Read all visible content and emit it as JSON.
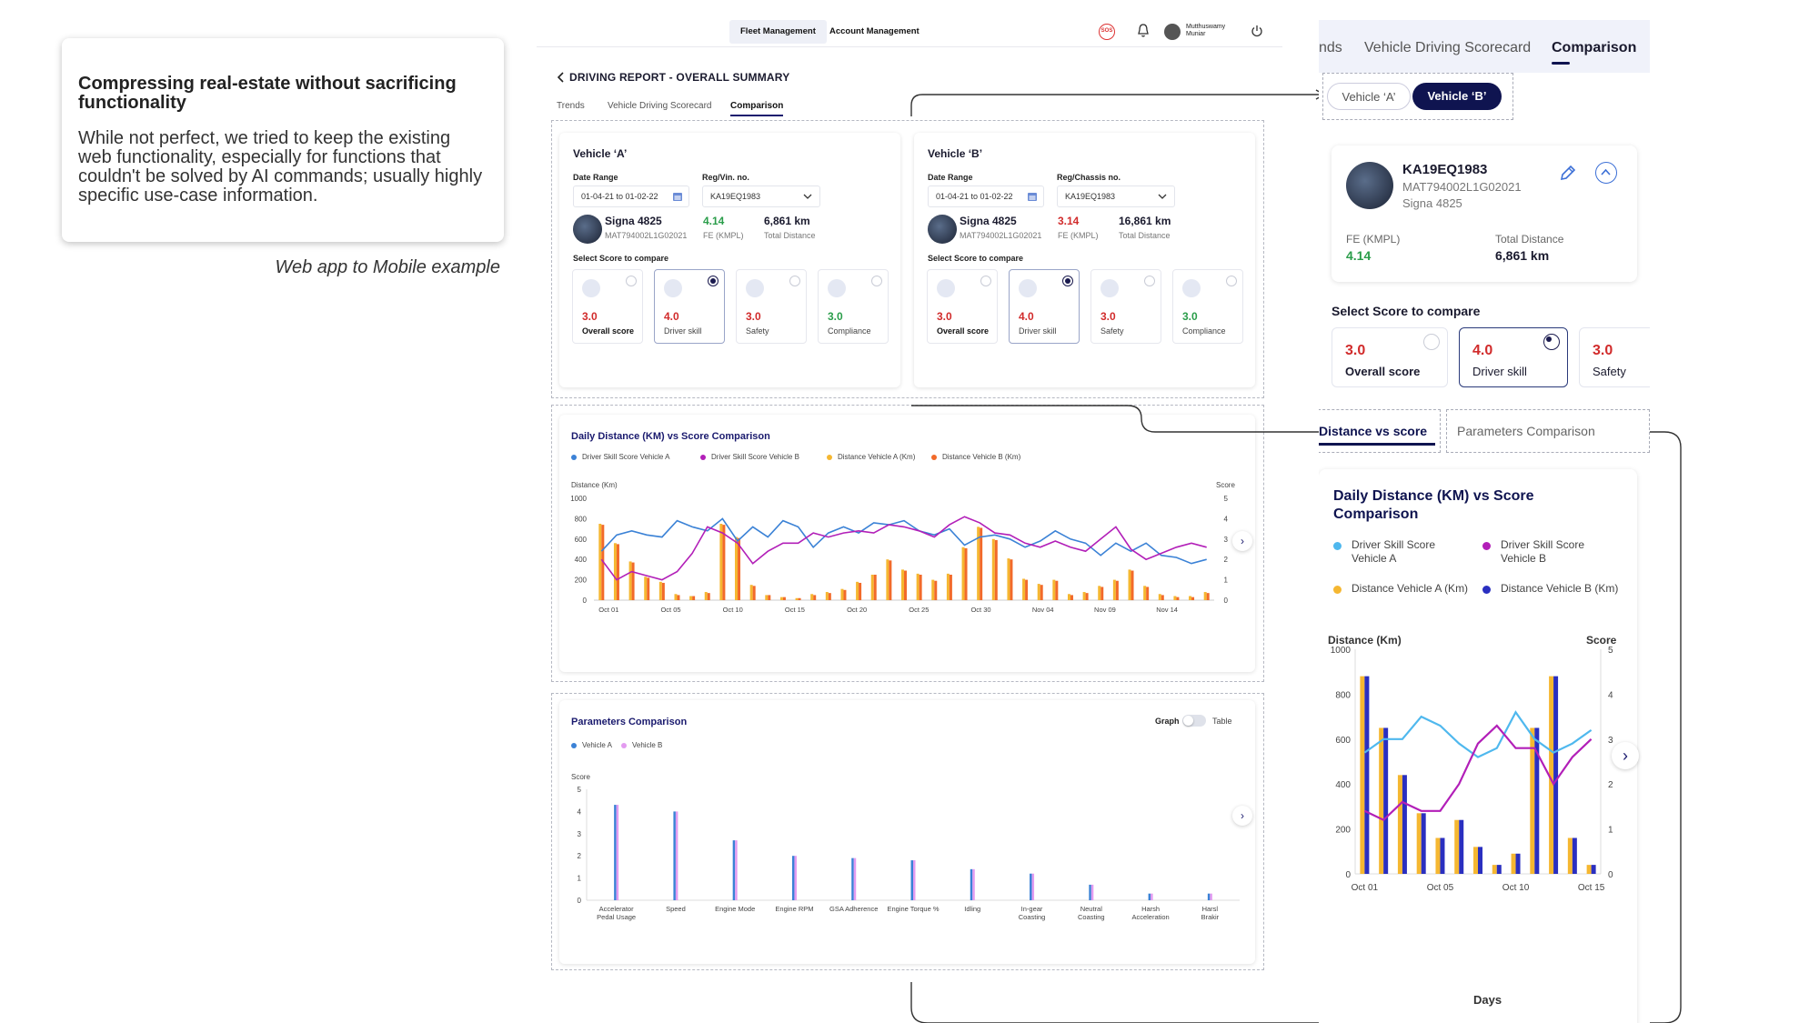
{
  "note": {
    "title": "Compressing real-estate without sacrificing functionality",
    "body": "While not perfect, we tried to keep the existing web functionality, especially for functions that couldn't be solved by AI commands; usually highly specific use-case information.",
    "caption": "Web app to Mobile example"
  },
  "desktop": {
    "top_tabs": [
      "Fleet Management",
      "Account Management"
    ],
    "sos": "SOS",
    "user_name_1": "Mutthuswamy",
    "user_name_2": "Muniar",
    "page_title": "DRIVING REPORT - OVERALL SUMMARY",
    "sub_tabs": [
      "Trends",
      "Vehicle Driving Scorecard",
      "Comparison"
    ],
    "vehicle_a": {
      "title": "Vehicle ‘A’",
      "date_label": "Date Range",
      "reg_label": "Reg/Vin. no.",
      "date_value": "01-04-21 to 01-02-22",
      "reg_value": "KA19EQ1983",
      "name": "Signa 4825",
      "vin": "MAT794002L1G02021",
      "fe_value": "4.14",
      "fe_label": "FE (KMPL)",
      "distance_value": "6,861 km",
      "distance_label": "Total Distance",
      "select_label": "Select Score to compare",
      "scores": [
        {
          "value": "3.0",
          "label": "Overall score"
        },
        {
          "value": "4.0",
          "label": "Driver skill"
        },
        {
          "value": "3.0",
          "label": "Safety"
        },
        {
          "value": "3.0",
          "label": "Compliance"
        }
      ]
    },
    "vehicle_b": {
      "title": "Vehicle ‘B’",
      "date_label": "Date Range",
      "reg_label": "Reg/Chassis no.",
      "date_value": "01-04-21 to 01-02-22",
      "reg_value": "KA19EQ1983",
      "name": "Signa 4825",
      "vin": "MAT794002L1G02021",
      "fe_value": "3.14",
      "fe_label": "FE (KMPL)",
      "distance_value": "16,861 km",
      "distance_label": "Total Distance",
      "select_label": "Select Score to compare",
      "scores": [
        {
          "value": "3.0",
          "label": "Overall score"
        },
        {
          "value": "4.0",
          "label": "Driver skill"
        },
        {
          "value": "3.0",
          "label": "Safety"
        },
        {
          "value": "3.0",
          "label": "Compliance"
        }
      ]
    },
    "toggle_graph": "Graph",
    "toggle_table": "Table"
  },
  "mobile": {
    "tabs": [
      "nds",
      "Vehicle Driving Scorecard",
      "Comparison"
    ],
    "pill_a": "Vehicle ‘A’",
    "pill_b": "Vehicle ‘B’",
    "reg": "KA19EQ1983",
    "vin": "MAT794002L1G02021",
    "model": "Signa 4825",
    "fe_label": "FE (KMPL)",
    "fe_value": "4.14",
    "dist_label": "Total Distance",
    "dist_value": "6,861 km",
    "select_label": "Select Score to compare",
    "scores": [
      {
        "value": "3.0",
        "label": "Overall score"
      },
      {
        "value": "4.0",
        "label": "Driver skill"
      },
      {
        "value": "3.0",
        "label": "Safety"
      }
    ],
    "tab_dist": "Distance vs score",
    "tab_params": "Parameters Comparison",
    "chart_title_1": "Daily Distance (KM) vs Score",
    "chart_title_2": "Comparison",
    "legend": [
      "Driver Skill Score Vehicle A",
      "Driver Skill Score Vehicle B",
      "Distance Vehicle A (Km)",
      "Distance Vehicle B (Km)"
    ],
    "y_left_label": "Distance (Km)",
    "y_right_label": "Score",
    "x_label": "Days"
  },
  "colors": {
    "skill_a": "#3b82d6",
    "skill_b": "#b21fb8",
    "dist_a": "#f5b731",
    "dist_b": "#f26a2a",
    "mobile_skill_a": "#4fb8ee",
    "mobile_dist_b": "#2a2fc0",
    "red": "#d12b2b",
    "green": "#2a9d4a",
    "navy": "#0f1450"
  },
  "chart_data": [
    {
      "type": "bar",
      "title": "Daily Distance (KM) vs Score Comparison",
      "xlabel": "",
      "ylabel": "Distance (Km)",
      "y2label": "Score",
      "ylim": [
        0,
        1000
      ],
      "y2lim": [
        0,
        5
      ],
      "yticks": [
        "1000",
        "800",
        "600",
        "400",
        "200",
        "0"
      ],
      "y2ticks": [
        "5",
        "4",
        "3",
        "2",
        "1",
        "0"
      ],
      "xtick_labels": [
        "Oct 01",
        "Oct 05",
        "Oct 10",
        "Oct 15",
        "Oct 20",
        "Oct 25",
        "Oct 30",
        "Nov 04",
        "Nov 09",
        "Nov 14"
      ],
      "legend": [
        "Driver Skill Score Vehicle A",
        "Driver Skill Score Vehicle B",
        "Distance Vehicle A (Km)",
        "Distance Vehicle B (Km)"
      ],
      "series": [
        {
          "name": "Distance Vehicle A (Km)",
          "values": [
            750,
            560,
            380,
            230,
            180,
            60,
            40,
            80,
            750,
            620,
            150,
            50,
            30,
            20,
            60,
            80,
            110,
            180,
            250,
            400,
            300,
            260,
            200,
            260,
            520,
            720,
            600,
            410,
            210,
            160,
            200,
            60,
            80,
            140,
            200,
            300,
            140,
            60,
            40,
            40,
            80
          ]
        },
        {
          "name": "Distance Vehicle B (Km)",
          "values": [
            740,
            550,
            370,
            220,
            170,
            50,
            40,
            70,
            740,
            610,
            140,
            50,
            30,
            20,
            50,
            70,
            100,
            170,
            250,
            390,
            290,
            250,
            190,
            250,
            510,
            710,
            590,
            400,
            200,
            150,
            190,
            50,
            70,
            130,
            190,
            290,
            130,
            50,
            30,
            30,
            70
          ]
        },
        {
          "name": "Driver Skill Score Vehicle A",
          "values": [
            2.4,
            3.2,
            3.4,
            3.2,
            3.1,
            3.9,
            3.6,
            3.4,
            4.0,
            2.9,
            3.6,
            3.1,
            3.9,
            3.6,
            2.6,
            3.3,
            3.6,
            3.3,
            3.8,
            3.7,
            3.9,
            3.4,
            3.2,
            3.5,
            2.7,
            3.1,
            3.2,
            3.0,
            2.6,
            2.9,
            3.4,
            3.0,
            2.8,
            2.2,
            2.8,
            2.4,
            2.8,
            2.2,
            2.1,
            1.8,
            2.0
          ]
        },
        {
          "name": "Driver Skill Score Vehicle B",
          "values": [
            2.0,
            1.0,
            1.4,
            1.2,
            1.0,
            1.4,
            2.3,
            3.6,
            3.3,
            2.8,
            1.8,
            2.4,
            2.8,
            2.8,
            3.3,
            3.1,
            3.3,
            3.4,
            3.3,
            3.7,
            3.6,
            3.4,
            3.1,
            3.7,
            4.1,
            3.8,
            3.3,
            3.2,
            2.8,
            2.6,
            2.9,
            2.6,
            2.4,
            3.0,
            3.6,
            2.5,
            2.0,
            2.3,
            2.6,
            2.8,
            2.6
          ]
        }
      ]
    },
    {
      "type": "bar",
      "title": "Parameters Comparison",
      "ylabel": "Score",
      "ylim": [
        0,
        5
      ],
      "yticks": [
        "5",
        "4",
        "3",
        "2",
        "1",
        "0"
      ],
      "categories": [
        "Accelerator Pedal Usage",
        "Speed",
        "Engine Mode",
        "Engine RPM",
        "GSA Adherence",
        "Engine Torque %",
        "Idling",
        "In-gear Coasting",
        "Neutral Coasting",
        "Harsh Acceleration",
        "Harsh Braking"
      ],
      "category_labels": [
        [
          "Accelerator",
          "Pedal Usage"
        ],
        [
          "Speed"
        ],
        [
          "Engine Mode"
        ],
        [
          "Engine RPM"
        ],
        [
          "GSA Adherence"
        ],
        [
          "Engine Torque %"
        ],
        [
          "Idling"
        ],
        [
          "In-gear",
          "Coasting"
        ],
        [
          "Neutral",
          "Coasting"
        ],
        [
          "Harsh",
          "Acceleration"
        ],
        [
          "Harsl",
          "Brakir"
        ]
      ],
      "legend": [
        "Vehicle A",
        "Vehicle B"
      ],
      "series": [
        {
          "name": "Vehicle A",
          "values": [
            4.3,
            4.0,
            2.7,
            2.0,
            1.9,
            1.8,
            1.4,
            1.2,
            0.7,
            0.3,
            0.3
          ]
        },
        {
          "name": "Vehicle B",
          "values": [
            4.3,
            4.0,
            2.7,
            2.0,
            1.9,
            1.8,
            1.4,
            1.2,
            0.7,
            0.3,
            0.3
          ]
        }
      ]
    },
    {
      "type": "bar",
      "title": "Daily Distance (KM) vs Score Comparison",
      "ylabel": "Distance (Km)",
      "y2label": "Score",
      "xlabel": "Days",
      "ylim": [
        0,
        1000
      ],
      "y2lim": [
        0,
        5
      ],
      "yticks": [
        "1000",
        "800",
        "600",
        "400",
        "200",
        "0"
      ],
      "y2ticks": [
        "5",
        "4",
        "3",
        "2",
        "1",
        "0"
      ],
      "xtick_labels": [
        "Oct 01",
        "Oct 05",
        "Oct 10",
        "Oct 15"
      ],
      "series": [
        {
          "name": "Distance Vehicle A (Km)",
          "values": [
            880,
            650,
            440,
            270,
            160,
            240,
            120,
            40,
            90,
            650,
            880,
            160,
            40
          ]
        },
        {
          "name": "Distance Vehicle B (Km)",
          "values": [
            880,
            650,
            440,
            270,
            160,
            240,
            120,
            40,
            90,
            650,
            880,
            160,
            40
          ]
        },
        {
          "name": "Driver Skill Score Vehicle A",
          "values": [
            2.7,
            3.0,
            3.0,
            3.5,
            3.3,
            2.9,
            2.6,
            2.8,
            3.6,
            3.0,
            2.7,
            2.9,
            3.2
          ]
        },
        {
          "name": "Driver Skill Score Vehicle B",
          "values": [
            1.4,
            1.2,
            1.6,
            1.4,
            1.4,
            2.0,
            2.9,
            3.3,
            2.8,
            2.8,
            2.0,
            2.6,
            3.0
          ]
        }
      ]
    }
  ]
}
